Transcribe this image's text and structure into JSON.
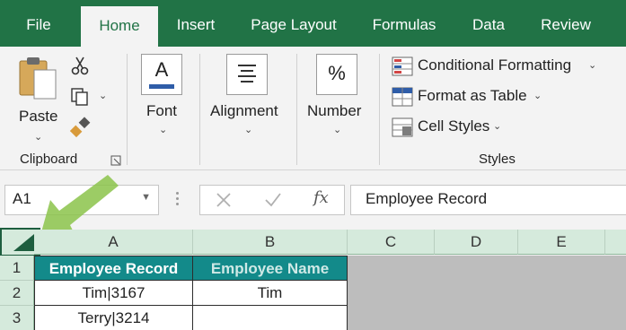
{
  "tabs": [
    "File",
    "Home",
    "Insert",
    "Page Layout",
    "Formulas",
    "Data",
    "Review"
  ],
  "ribbon": {
    "clipboard": {
      "paste_label": "Paste",
      "group_label": "Clipboard"
    },
    "font_label": "Font",
    "alignment_label": "Alignment",
    "number": {
      "label": "Number",
      "symbol": "%"
    },
    "styles": {
      "conditional_formatting": "Conditional Formatting",
      "format_as_table": "Format as Table",
      "cell_styles": "Cell Styles",
      "group_label": "Styles"
    }
  },
  "formula_bar": {
    "name_box": "A1",
    "fx_label": "fx",
    "formula": "Employee Record"
  },
  "grid": {
    "columns": [
      "A",
      "B",
      "C",
      "D",
      "E"
    ],
    "rows": [
      "1",
      "2",
      "3"
    ],
    "cells": {
      "A1": "Employee Record",
      "B1": "Employee Name",
      "A2": "Tim|3167",
      "B2": "Tim",
      "A3": "Terry|3214",
      "B3": ""
    }
  },
  "colors": {
    "excel_green": "#217346",
    "header_fill": "#138a8a",
    "grid_header": "#d5eadc",
    "empty_area": "#bdbdbd"
  }
}
